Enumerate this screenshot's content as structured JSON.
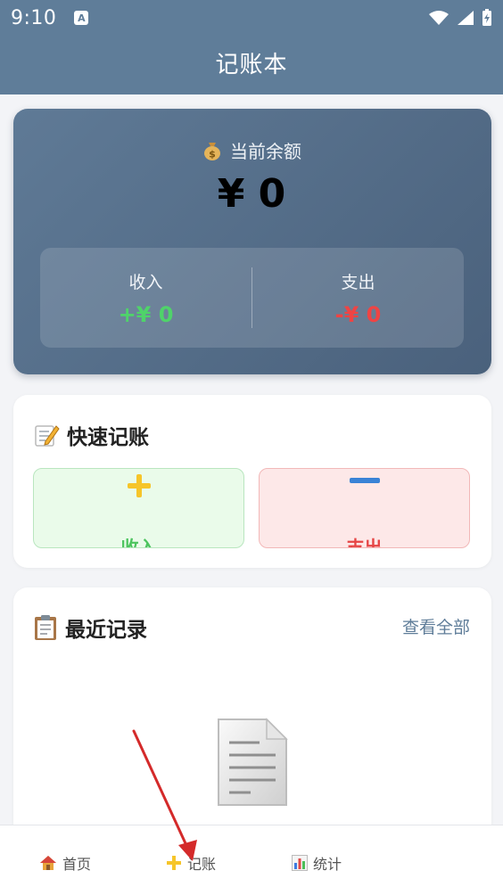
{
  "status_bar": {
    "time": "9:10",
    "notif_letter": "A"
  },
  "header": {
    "title": "记账本"
  },
  "balance": {
    "label": "当前余额",
    "icon": "money-bag-icon",
    "value": "¥ 0",
    "income_label": "收入",
    "income_value": "+¥ 0",
    "expense_label": "支出",
    "expense_value": "-¥ 0"
  },
  "quick": {
    "title": "快速记账",
    "icon": "memo-icon",
    "income_label": "收入",
    "expense_label": "支出"
  },
  "recent": {
    "title": "最近记录",
    "icon": "clipboard-icon",
    "view_all": "查看全部",
    "empty_icon": "document-icon"
  },
  "nav": {
    "items": [
      {
        "label": "首页",
        "icon": "house-icon"
      },
      {
        "label": "记账",
        "icon": "plus-icon"
      },
      {
        "label": "统计",
        "icon": "bar-chart-icon"
      }
    ]
  },
  "colors": {
    "header": "#5f7d99",
    "income": "#4cc45e",
    "expense": "#e64545",
    "accent_link": "#5f7d99",
    "annotation_arrow": "#d42a2a"
  }
}
